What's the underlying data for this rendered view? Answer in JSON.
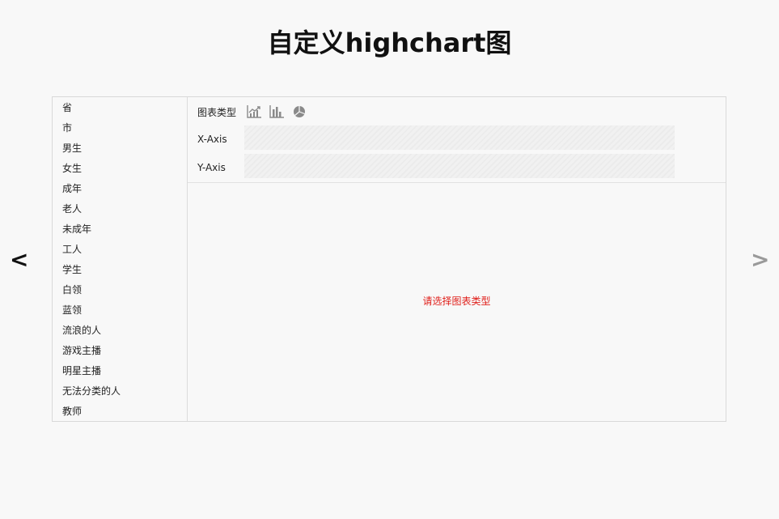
{
  "header": {
    "title": "自定义highchart图"
  },
  "nav": {
    "prev_label": "<",
    "next_label": ">"
  },
  "sidebar": {
    "items": [
      {
        "label": "省"
      },
      {
        "label": "市"
      },
      {
        "label": "男生"
      },
      {
        "label": "女生"
      },
      {
        "label": "成年"
      },
      {
        "label": "老人"
      },
      {
        "label": "未成年"
      },
      {
        "label": "工人"
      },
      {
        "label": "学生"
      },
      {
        "label": "白领"
      },
      {
        "label": "蓝领"
      },
      {
        "label": "流浪的人"
      },
      {
        "label": "游戏主播"
      },
      {
        "label": "明星主播"
      },
      {
        "label": "无法分类的人"
      },
      {
        "label": "教师"
      }
    ]
  },
  "config": {
    "chart_type_label": "图表类型",
    "chart_type_icons": [
      "line-chart-icon",
      "bar-chart-icon",
      "pie-chart-icon"
    ],
    "x_axis_label": "X-Axis",
    "y_axis_label": "Y-Axis"
  },
  "chart_area": {
    "placeholder": "请选择图表类型"
  },
  "colors": {
    "background": "#f8f8f8",
    "border": "#d9d9d9",
    "icon_gray": "#8a8a8a",
    "placeholder_red": "#e0201b",
    "next_arrow_gray": "#9a9a9a"
  }
}
